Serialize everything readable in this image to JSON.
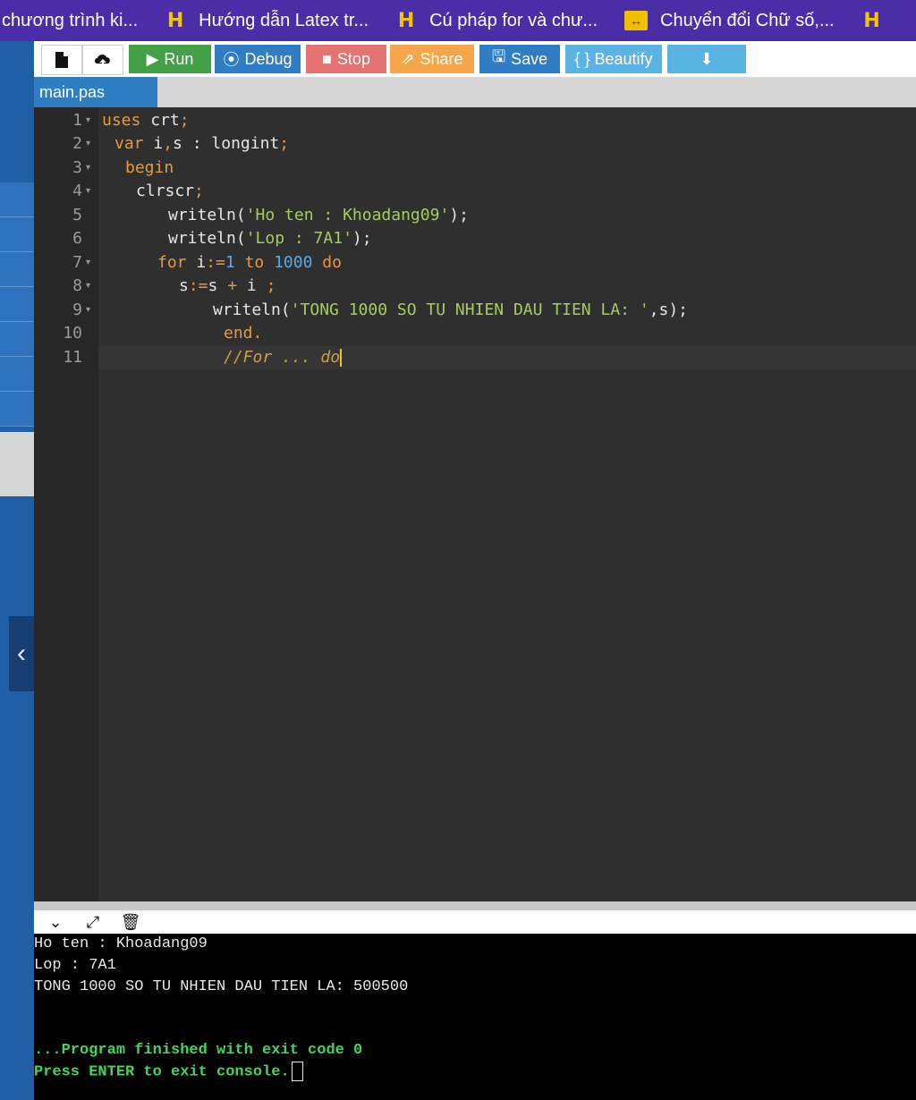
{
  "bookmarks": [
    {
      "label": "chương trình ki...",
      "icon": "none"
    },
    {
      "label": "Hướng dẫn Latex tr...",
      "icon": "h-logo-icon"
    },
    {
      "label": "Cú pháp for và chư...",
      "icon": "h-logo-icon"
    },
    {
      "label": "Chuyển đổi Chữ số,...",
      "icon": "convert-icon"
    },
    {
      "label": "",
      "icon": "h-logo-icon"
    }
  ],
  "toolbar": {
    "run": "Run",
    "debug": "Debug",
    "stop": "Stop",
    "share": "Share",
    "save": "Save",
    "beautify": "{ } Beautify"
  },
  "file_tab": "main.pas",
  "editor": {
    "line_numbers": [
      "1",
      "2",
      "3",
      "4",
      "5",
      "6",
      "7",
      "8",
      "9",
      "10",
      "11"
    ],
    "lines": [
      [
        "uses",
        " crt",
        ";"
      ],
      [
        "var",
        " i",
        ",",
        "s : longint",
        ";"
      ],
      [
        "begin"
      ],
      [
        "clrscr",
        ";"
      ],
      [
        "writeln(",
        "'Ho ten : Khoadang09'",
        ");"
      ],
      [
        "writeln(",
        "'Lop : 7A1'",
        ");"
      ],
      [
        "for",
        " i",
        ":=",
        "1",
        " to ",
        "1000",
        " do"
      ],
      [
        "s",
        ":=",
        "s ",
        "+",
        " i ",
        ";"
      ],
      [
        "writeln(",
        "'TONG 1000 SO TU NHIEN DAU TIEN LA: '",
        ",s);"
      ],
      [
        "end."
      ],
      [
        "//For ... do"
      ]
    ]
  },
  "console": {
    "lines": [
      "Ho ten : Khoadang09",
      "Lop : 7A1",
      "TONG 1000 SO TU NHIEN DAU TIEN LA: 500500",
      "...Program finished with exit code 0",
      "Press ENTER to exit console."
    ]
  },
  "colors": {
    "keyword": "#e69a3c",
    "string": "#a8cc5c",
    "number": "#5aa9e6",
    "console_success": "#41d65a"
  }
}
